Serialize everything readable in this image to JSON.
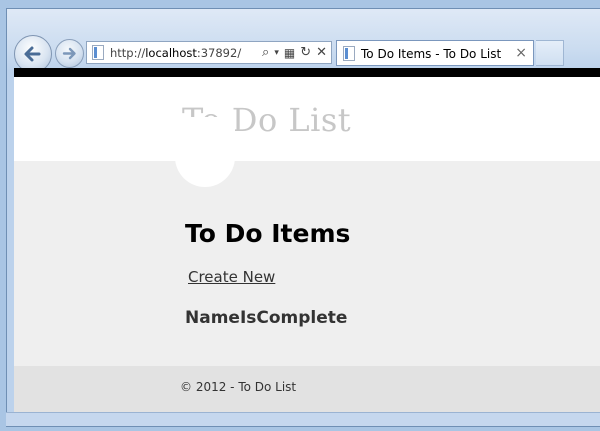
{
  "browser": {
    "address": {
      "prefix": "http://",
      "host": "localhost",
      "port": ":37892/"
    },
    "tab": {
      "title": "To Do Items - To Do List",
      "close": "×"
    },
    "icons": {
      "back": "back-arrow-icon",
      "forward": "forward-arrow-icon",
      "search": "search-icon",
      "dropdown": "chevron-down-icon",
      "compat": "compatibility-view-icon",
      "refresh": "refresh-icon",
      "stop": "stop-icon"
    }
  },
  "site": {
    "title": "To Do List",
    "heading": "To Do Items",
    "create_link": "Create New",
    "table_header": "NameIsComplete",
    "footer": "© 2012 - To Do List"
  },
  "colors": {
    "site_title": "#c7c7c7",
    "content_band": "#efefef",
    "footer_band": "#e2e2e2",
    "browser_chrome": "#cbdcf0"
  }
}
